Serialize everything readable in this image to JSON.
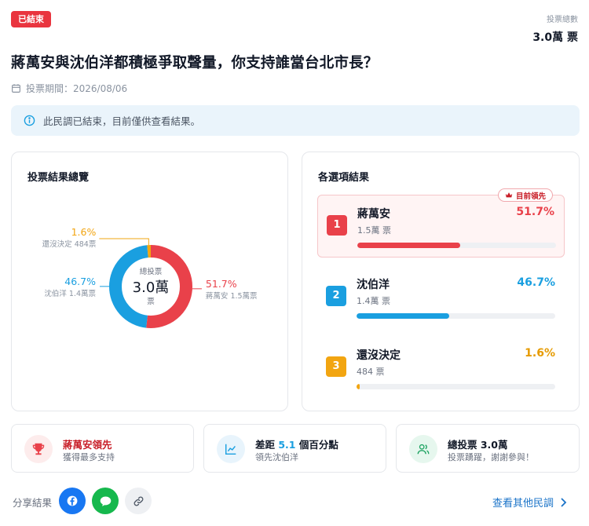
{
  "status_badge": "已結束",
  "total_header": {
    "label": "投票總數",
    "value": "3.0萬 票"
  },
  "title": "蔣萬安與沈伯洋都積極爭取聲量，你支持誰當台北市長？",
  "period": "投票期間：2026/08/06",
  "notice": "此民調已結束，目前僅供查看結果。",
  "overview": {
    "title": "投票結果總覽",
    "center_label": "總投票",
    "center_value": "3.0萬",
    "center_unit": "票"
  },
  "results": {
    "title": "各選項結果",
    "leading_tag": "目前領先"
  },
  "chart_data": {
    "type": "pie",
    "categories": [
      "蔣萬安",
      "沈伯洋",
      "還沒決定"
    ],
    "values": [
      51.7,
      46.7,
      1.6
    ],
    "pct_labels": [
      "51.7%",
      "46.7%",
      "1.6%"
    ],
    "vote_labels": [
      "1.5萬票",
      "1.4萬票",
      "484票"
    ],
    "colors": [
      "#e9414a",
      "#1a9fe0",
      "#f2a511"
    ]
  },
  "options": [
    {
      "rank": "1",
      "name": "蔣萬安",
      "votes": "1.5萬 票",
      "pct": "51.7%",
      "value": 51.7,
      "color": "#e9414a"
    },
    {
      "rank": "2",
      "name": "沈伯洋",
      "votes": "1.4萬 票",
      "pct": "46.7%",
      "value": 46.7,
      "color": "#1a9fe0"
    },
    {
      "rank": "3",
      "name": "還沒決定",
      "votes": "484 票",
      "pct": "1.6%",
      "value": 1.6,
      "color": "#f2a511"
    }
  ],
  "stats": {
    "leader": {
      "title": "蔣萬安領先",
      "sub": "獲得最多支持"
    },
    "gap": {
      "prefix": "差距 ",
      "value": "5.1",
      "suffix": " 個百分點",
      "sub": "領先沈伯洋"
    },
    "total": {
      "title": "總投票 3.0萬",
      "sub": "投票踴躍，謝謝參與！"
    }
  },
  "share": {
    "label": "分享結果"
  },
  "more_link": "查看其他民調",
  "icons": [
    "calendar-icon",
    "info-icon",
    "crown-icon",
    "trophy-icon",
    "trend-chart-icon",
    "users-icon",
    "facebook-icon",
    "line-chat-icon",
    "link-icon",
    "chevron-right-icon"
  ]
}
